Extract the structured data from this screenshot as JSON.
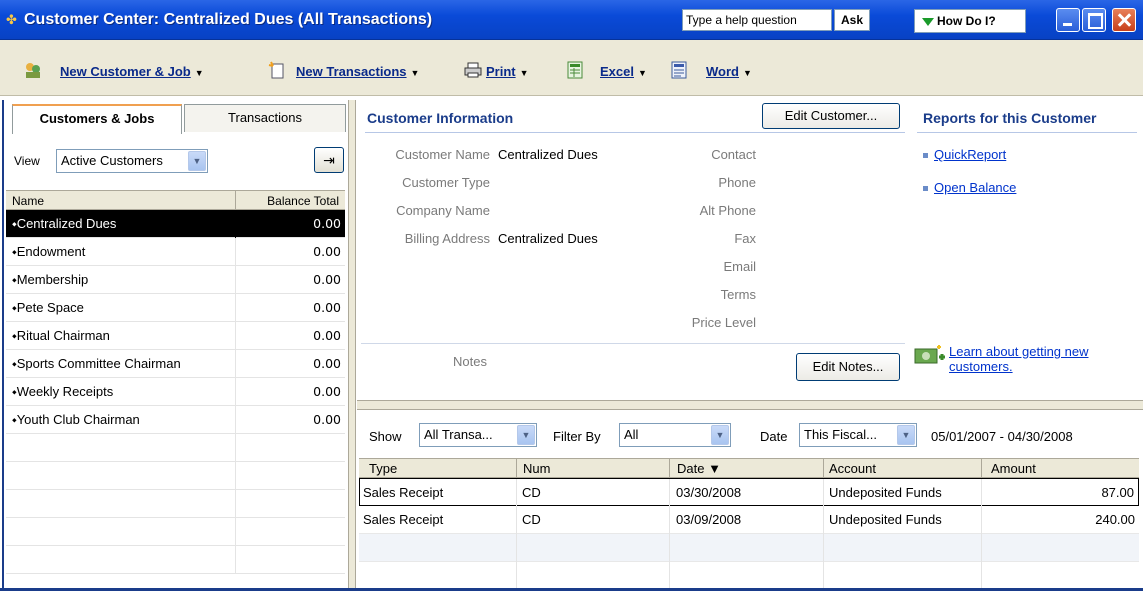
{
  "window": {
    "title": "Customer Center: Centralized Dues (All Transactions)",
    "help_placeholder": "Type a help question",
    "ask_label": "Ask",
    "how_do_i_label": "How Do I?"
  },
  "toolbar": {
    "new_customer_job": "New Customer & Job",
    "new_transactions": "New Transactions",
    "print": "Print",
    "excel": "Excel",
    "word": "Word"
  },
  "left": {
    "tabs": [
      "Customers & Jobs",
      "Transactions"
    ],
    "view_label": "View",
    "view_value": "Active Customers",
    "columns": [
      "Name",
      "Balance Total"
    ],
    "customers": [
      {
        "name": "Centralized Dues",
        "balance": "0.00"
      },
      {
        "name": "Endowment",
        "balance": "0.00"
      },
      {
        "name": "Membership",
        "balance": "0.00"
      },
      {
        "name": "Pete Space",
        "balance": "0.00"
      },
      {
        "name": "Ritual Chairman",
        "balance": "0.00"
      },
      {
        "name": "Sports Committee Chairman",
        "balance": "0.00"
      },
      {
        "name": "Weekly Receipts",
        "balance": "0.00"
      },
      {
        "name": "Youth Club Chairman",
        "balance": "0.00"
      }
    ]
  },
  "info": {
    "title": "Customer Information",
    "edit_customer": "Edit Customer...",
    "labels": {
      "customer_name": "Customer Name",
      "customer_type": "Customer Type",
      "company_name": "Company Name",
      "billing_address": "Billing Address",
      "contact": "Contact",
      "phone": "Phone",
      "alt_phone": "Alt Phone",
      "fax": "Fax",
      "email": "Email",
      "terms": "Terms",
      "price_level": "Price Level",
      "notes": "Notes"
    },
    "customer_name": "Centralized Dues",
    "billing_address": "Centralized Dues",
    "edit_notes": "Edit Notes...",
    "learn_link": "Learn about getting new customers."
  },
  "reports": {
    "title": "Reports for this Customer",
    "links": [
      "QuickReport",
      "Open Balance"
    ]
  },
  "transactions": {
    "show_label": "Show",
    "show_value": "All Transa...",
    "filter_label": "Filter By",
    "filter_value": "All",
    "date_label": "Date",
    "date_value": "This Fiscal...",
    "date_range": "05/01/2007 - 04/30/2008",
    "columns": [
      "Type",
      "Num",
      "Date ▼",
      "Account",
      "Amount"
    ],
    "rows": [
      {
        "type": "Sales Receipt",
        "num": "CD",
        "date": "03/30/2008",
        "account": "Undeposited Funds",
        "amount": "87.00"
      },
      {
        "type": "Sales Receipt",
        "num": "CD",
        "date": "03/09/2008",
        "account": "Undeposited Funds",
        "amount": "240.00"
      }
    ]
  }
}
